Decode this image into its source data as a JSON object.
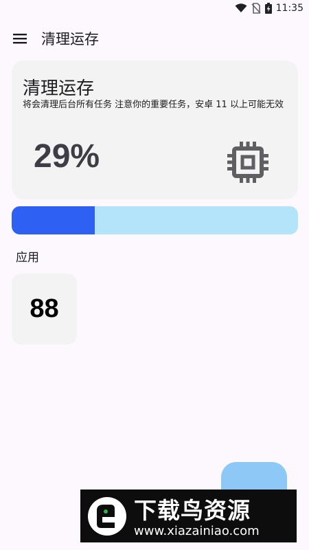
{
  "status_bar": {
    "time": "11:35"
  },
  "appbar": {
    "title": "清理运存"
  },
  "card": {
    "title": "清理运存",
    "description": "将会清理后台所有任务 注意你的重要任务，安卓 11 以上可能无效",
    "percent_label": "29%",
    "icon": "memory-chip-icon"
  },
  "progress": {
    "value": 0.29,
    "fill_color": "#2e61f3",
    "track_color": "#b3e4f9"
  },
  "apps_section": {
    "label": "应用",
    "count": "88"
  },
  "fab": {
    "color": "#8ec8f6"
  },
  "watermark": {
    "title": "下载鸟资源",
    "url": "www.xiazainiao.com"
  }
}
